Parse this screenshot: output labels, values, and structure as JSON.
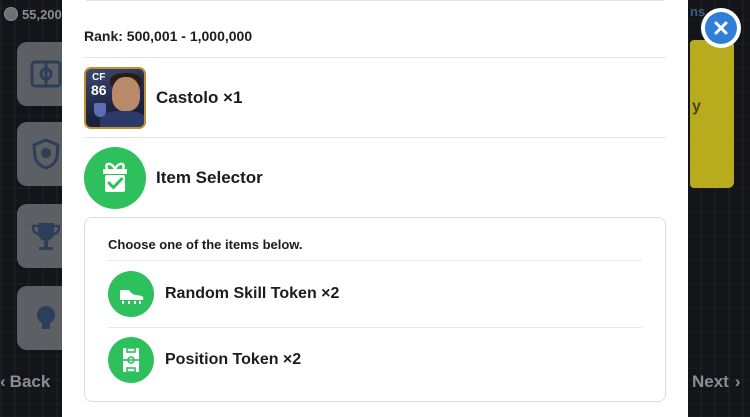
{
  "background": {
    "coins": "55,200",
    "back_label": "Back",
    "next_label": "Next",
    "tiles": [
      {
        "icon": "formation-icon"
      },
      {
        "icon": "shield-icon"
      },
      {
        "icon": "trophy-icon"
      },
      {
        "icon": "tips-icon"
      }
    ]
  },
  "modal": {
    "rank_label": "Rank: 500,001 - 1,000,000",
    "rewards": [
      {
        "label": "Castolo ×1",
        "icon": "player-card",
        "card_position": "CF",
        "card_rating": "86"
      },
      {
        "label": "Item Selector",
        "icon": "gift-check-icon"
      }
    ],
    "selector": {
      "instructions": "Choose one of the items below.",
      "options": [
        {
          "label": "Random Skill Token ×2",
          "icon": "boot-icon"
        },
        {
          "label": "Position Token ×2",
          "icon": "pitch-icon"
        }
      ]
    }
  },
  "close_icon": "close-icon",
  "colors": {
    "accent_green": "#2ec05c",
    "close_blue": "#2f7fd6",
    "card_gold": "#c3902f"
  }
}
